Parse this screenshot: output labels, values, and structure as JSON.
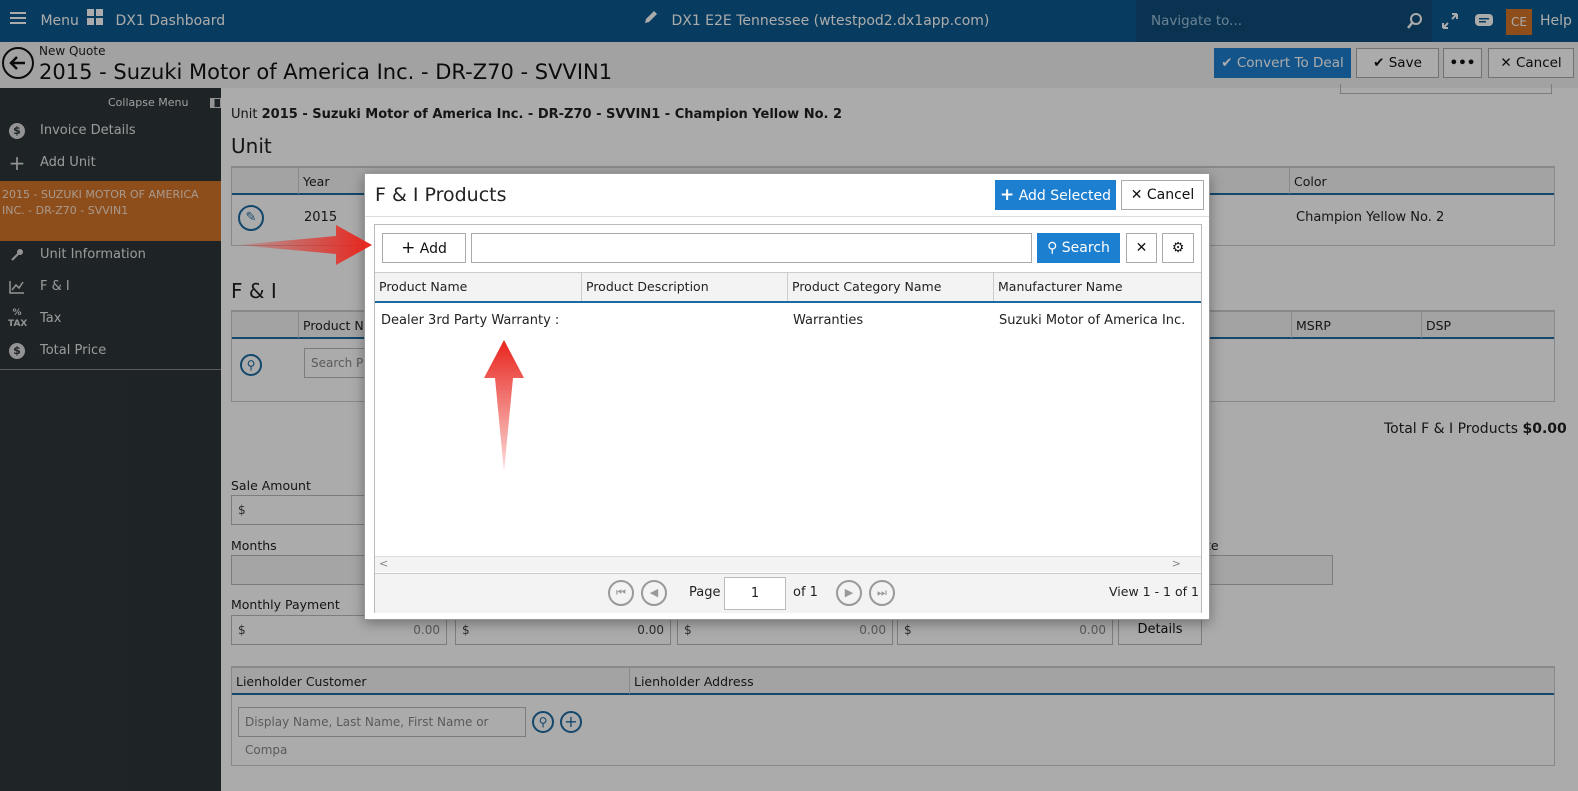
{
  "topbar": {
    "menu_label": "Menu",
    "dashboard_label": "DX1 Dashboard",
    "environment": "DX1 E2E Tennessee (wtestpod2.dx1app.com)",
    "navigate_placeholder": "Navigate to...",
    "avatar_initials": "CE",
    "help_label": "Help"
  },
  "titlebar": {
    "subtitle": "New Quote",
    "title": "2015 - Suzuki Motor of America Inc. - DR-Z70 - SVVIN1",
    "convert_label": "Convert To Deal",
    "save_label": "Save",
    "more_label": "•••",
    "cancel_label": "Cancel"
  },
  "sidebar": {
    "collapse_label": "Collapse Menu",
    "items": [
      {
        "label": "Invoice Details",
        "icon": "dollar-circle-icon"
      },
      {
        "label": "Add Unit",
        "icon": "plus-icon"
      },
      {
        "label": "2015 - SUZUKI MOTOR OF AMERICA INC. - DR-Z70 - SVVIN1",
        "active": true
      },
      {
        "label": "Unit Information",
        "icon": "key-icon"
      },
      {
        "label": "F & I",
        "icon": "chart-icon"
      },
      {
        "label": "Tax",
        "icon": "tax-icon"
      },
      {
        "label": "Total Price",
        "icon": "dollar-circle-icon"
      }
    ],
    "active_color": "#d4752a"
  },
  "main": {
    "unit_prefix": "Unit",
    "unit_line": "2015 - Suzuki Motor of America Inc. - DR-Z70 - SVVIN1 - Champion Yellow No. 2",
    "unit_heading": "Unit",
    "unit_grid": {
      "year_header": "Year",
      "color_header": "Color",
      "year_value": "2015",
      "color_value": "Champion Yellow No. 2"
    },
    "fi_heading": "F & I",
    "fi_grid": {
      "product_header": "Product Na",
      "msrp_header": "MSRP",
      "dsp_header": "DSP",
      "search_placeholder": "Search Pr"
    },
    "total_fi_label": "Total F & I Products",
    "total_fi_value": "$0.00",
    "sale_amount_label": "Sale Amount",
    "dollar_sign": "$",
    "months_label": "Months",
    "rate_label_fragment": "te",
    "monthly_payment_label": "Monthly Payment",
    "payments": [
      "0.00",
      "0.00",
      "0.00",
      "0.00"
    ],
    "details_label": "Details",
    "lien_grid": {
      "customer_header": "Lienholder Customer",
      "address_header": "Lienholder Address",
      "search_placeholder": "Display Name, Last Name, First Name or Compa"
    }
  },
  "modal": {
    "title": "F & I Products",
    "add_selected_label": "Add Selected",
    "cancel_label": "Cancel",
    "add_label": "Add",
    "search_label": "Search",
    "search_value": "",
    "columns": [
      "Product Name",
      "Product Description",
      "Product Category Name",
      "Manufacturer Name"
    ],
    "rows": [
      {
        "product_name": "Dealer 3rd Party Warranty :",
        "product_description": "",
        "category": "Warranties",
        "manufacturer": "Suzuki Motor of America Inc."
      }
    ],
    "pager": {
      "page_label": "Page",
      "page_value": "1",
      "of_label": "of 1",
      "view_label": "View 1 - 1 of 1"
    }
  },
  "colors": {
    "topbar": "#0b5a8f",
    "primary_button": "#1d7fcf",
    "annotation_arrow": "#e8241c"
  }
}
